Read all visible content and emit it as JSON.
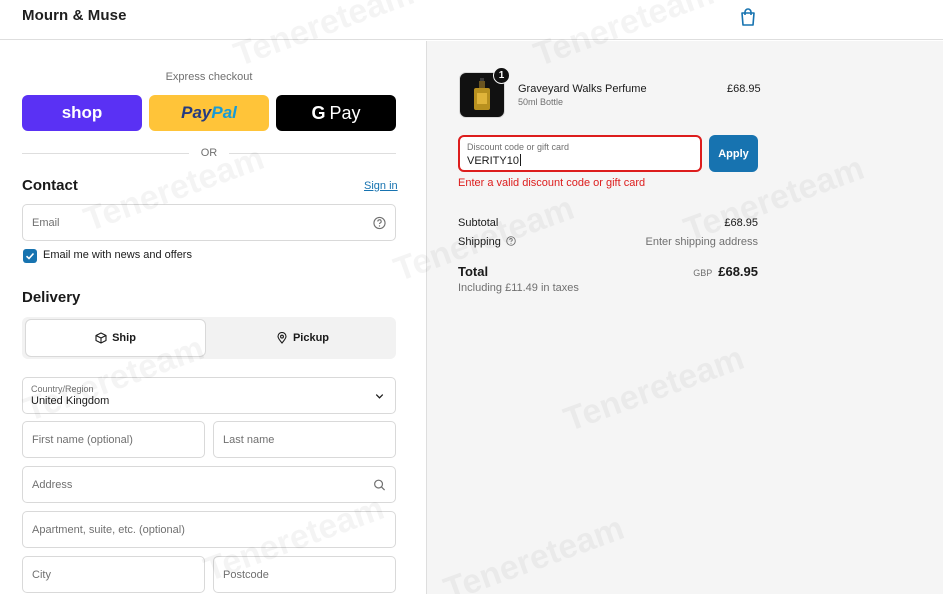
{
  "header": {
    "brand": "Mourn & Muse",
    "cart_icon": "shopping-bag-icon"
  },
  "express": {
    "label": "Express checkout",
    "shop_label": "shop",
    "paypal_label_a": "Pay",
    "paypal_label_b": "Pal",
    "gpay_g": "G",
    "gpay_label": "Pay",
    "or_label": "OR",
    "colors": {
      "shop": "#5a31f4",
      "paypal": "#ffc439",
      "gpay": "#000000"
    }
  },
  "contact": {
    "title": "Contact",
    "signin_label": "Sign in",
    "email_placeholder": "Email",
    "marketing_checked": true,
    "marketing_label": "Email me with news and offers"
  },
  "delivery": {
    "title": "Delivery",
    "ship_label": "Ship",
    "pickup_label": "Pickup",
    "country_label": "Country/Region",
    "country_value": "United Kingdom",
    "first_name_placeholder": "First name (optional)",
    "last_name_placeholder": "Last name",
    "address_placeholder": "Address",
    "apartment_placeholder": "Apartment, suite, etc. (optional)",
    "city_placeholder": "City",
    "postcode_placeholder": "Postcode"
  },
  "order": {
    "item": {
      "name": "Graveyard Walks Perfume",
      "variant": "50ml Bottle",
      "price": "£68.95",
      "quantity": "1"
    },
    "discount": {
      "label": "Discount code or gift card",
      "value": "VERITY10",
      "apply_label": "Apply",
      "error": "Enter a valid discount code or gift card"
    },
    "subtotal_label": "Subtotal",
    "subtotal_value": "£68.95",
    "shipping_label": "Shipping",
    "shipping_value": "Enter shipping address",
    "total_label": "Total",
    "total_currency": "GBP",
    "total_value": "£68.95",
    "taxes_note": "Including £11.49 in taxes"
  },
  "watermark": "Tenereteam",
  "colors": {
    "accent": "#1773b0",
    "error": "#dd1d1d"
  }
}
